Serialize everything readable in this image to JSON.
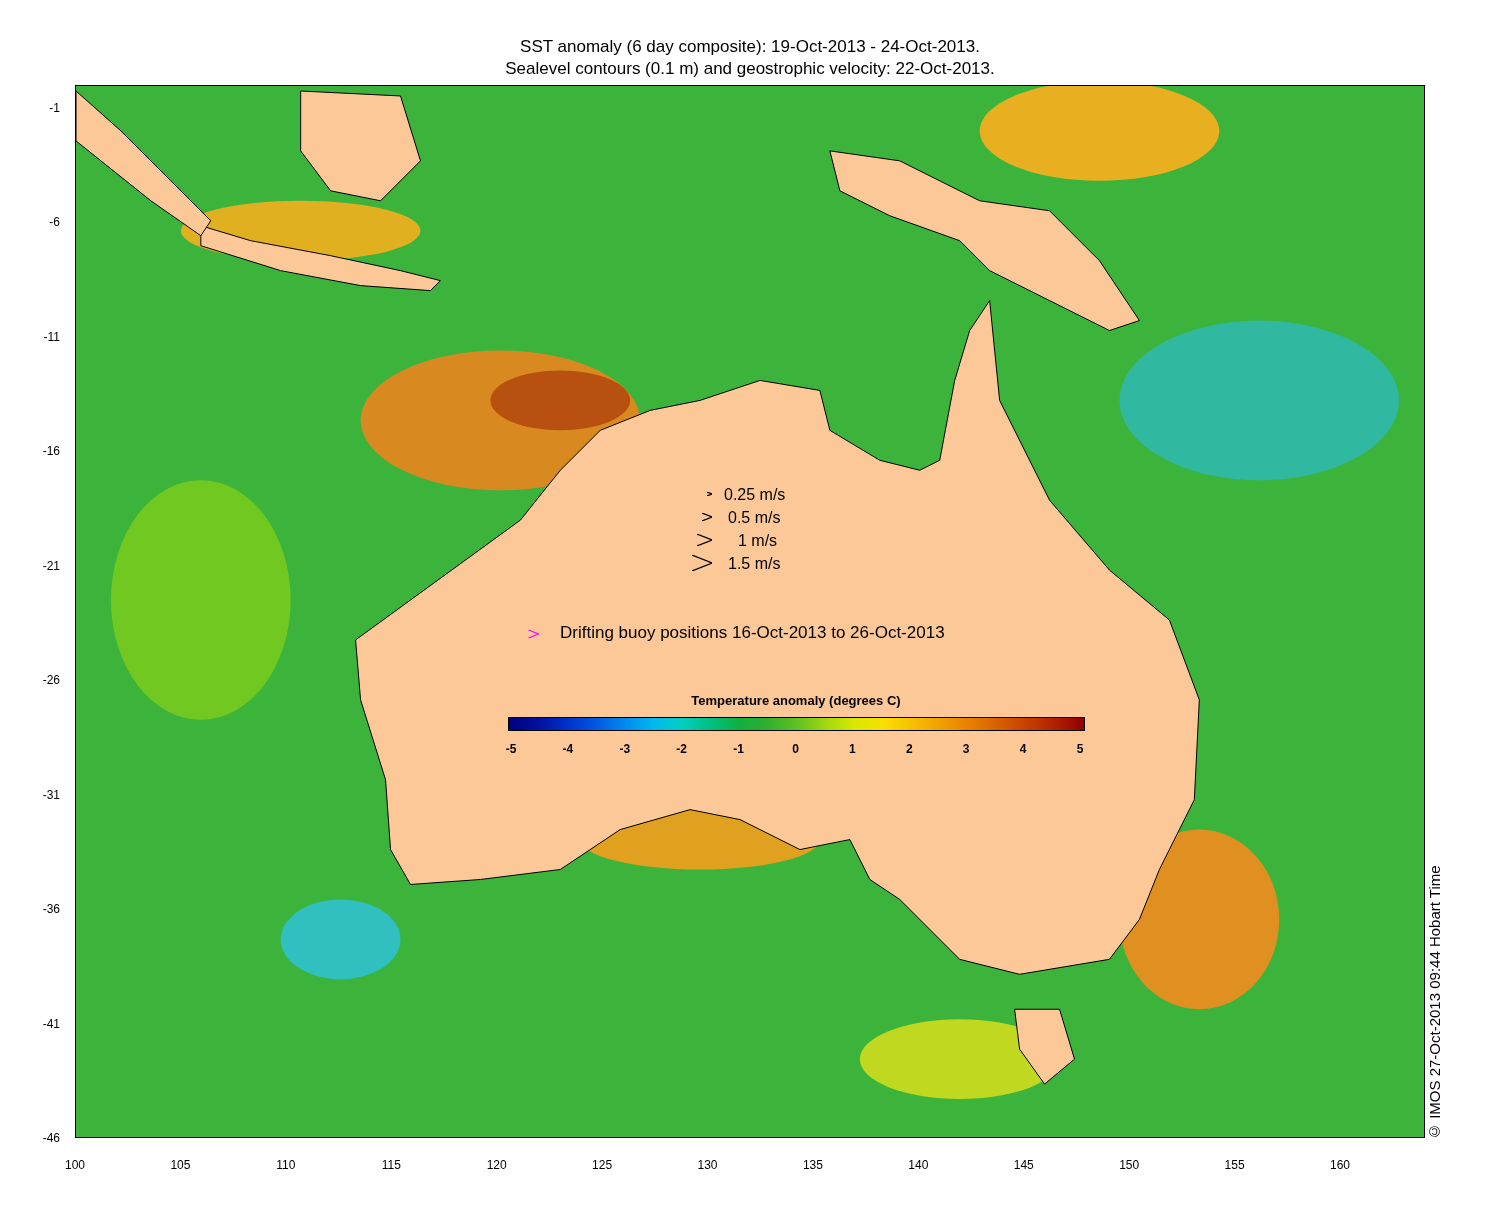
{
  "title_lines": [
    "SST anomaly (6 day composite): 19-Oct-2013 - 24-Oct-2013.",
    "Sealevel contours (0.1 m) and geostrophic velocity: 22-Oct-2013."
  ],
  "y_axis": {
    "ticks": [
      "-1",
      "-6",
      "-11",
      "-16",
      "-21",
      "-26",
      "-31",
      "-36",
      "-41",
      "-46"
    ]
  },
  "x_axis": {
    "ticks": [
      "100",
      "105",
      "110",
      "115",
      "120",
      "125",
      "130",
      "135",
      "140",
      "145",
      "150",
      "155",
      "160"
    ]
  },
  "velocity_scale": [
    {
      "label": "0.25 m/s"
    },
    {
      "label": "0.5 m/s"
    },
    {
      "label": "1 m/s"
    },
    {
      "label": "1.5 m/s"
    }
  ],
  "buoy_legend": {
    "label": "Drifting buoy positions 16-Oct-2013 to 26-Oct-2013"
  },
  "colorbar": {
    "title": "Temperature anomaly (degrees C)",
    "ticks": [
      "-5",
      "-4",
      "-3",
      "-2",
      "-1",
      "0",
      "1",
      "2",
      "3",
      "4",
      "5"
    ]
  },
  "credit": "© IMOS 27-Oct-2013 09:44 Hobart Time"
}
